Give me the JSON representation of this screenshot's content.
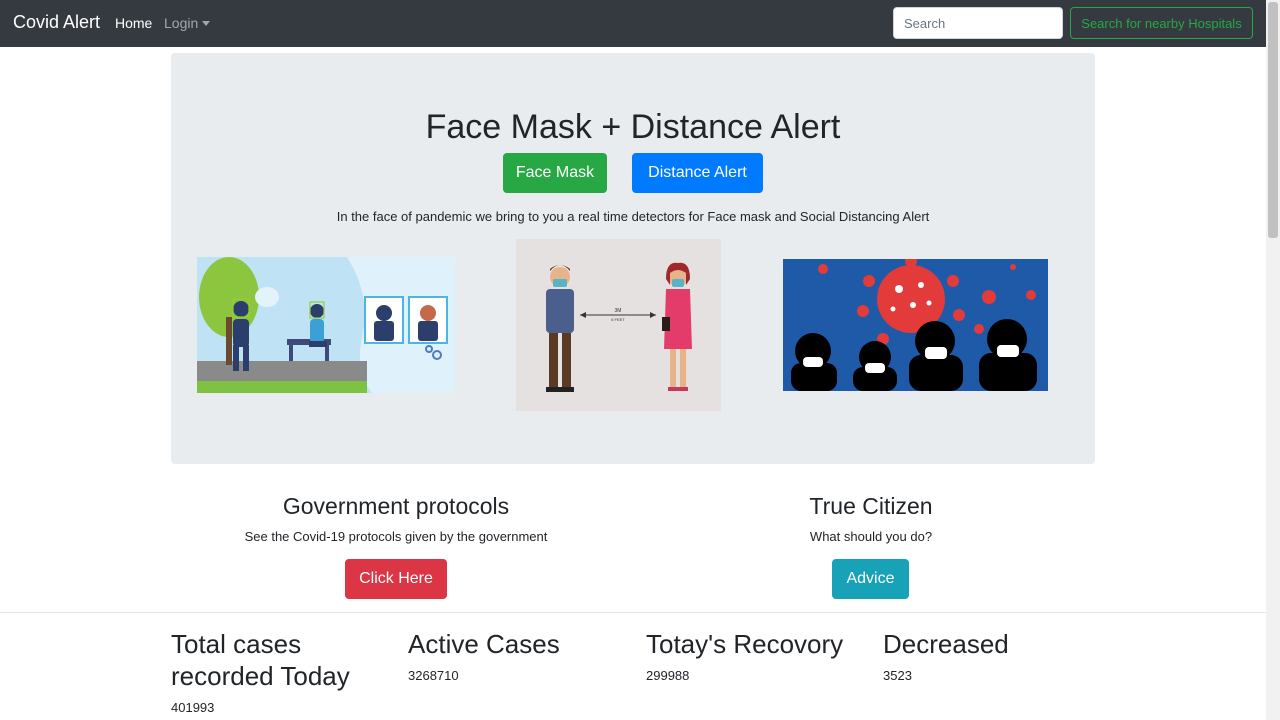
{
  "navbar": {
    "brand": "Covid Alert",
    "home": "Home",
    "login": "Login",
    "search_placeholder": "Search",
    "hospitals_button": "Search for nearby Hospitals"
  },
  "hero": {
    "title": "Face Mask + Distance Alert",
    "face_mask_button": "Face Mask",
    "distance_alert_button": "Distance Alert",
    "description": "In the face of pandemic we bring to you a real time detectors for Face mask and Social Distancing Alert",
    "distance_sign": [
      "3M",
      "6 FEET"
    ]
  },
  "protocols": {
    "title": "Government protocols",
    "text": "See the Covid-19 protocols given by the government",
    "button": "Click Here"
  },
  "citizen": {
    "title": "True Citizen",
    "text": "What should you do?",
    "button": "Advice"
  },
  "stats": [
    {
      "title": "Total cases recorded Today",
      "value": "401993"
    },
    {
      "title": "Active Cases",
      "value": "3268710"
    },
    {
      "title": "Totay's Recovory",
      "value": "299988"
    },
    {
      "title": "Decreased",
      "value": "3523"
    }
  ],
  "colors": {
    "navbar": "#343a40",
    "success": "#28a745",
    "primary": "#007bff",
    "danger": "#dc3545",
    "info": "#17a2b8",
    "jumbotron": "#e9ecef"
  }
}
